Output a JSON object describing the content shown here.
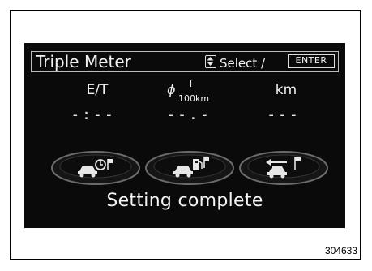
{
  "screen": {
    "title": "Triple Meter",
    "select_label": "Select /",
    "enter_key": "ENTER",
    "columns": [
      {
        "label": "E/T",
        "value": "-:--",
        "icon": "car-clock-icon"
      },
      {
        "label_prefix": "ϕ",
        "fraction_num": "l",
        "fraction_den": "100km",
        "value": "--.-",
        "icon": "car-fuel-pump-icon"
      },
      {
        "label": "km",
        "value": "---",
        "icon": "car-flag-icon"
      }
    ],
    "status": "Setting complete"
  },
  "figure_code": "304633",
  "colors": {
    "screen_bg": "#0a0a0a",
    "text": "#f0f0f0",
    "dial": "#5f5f5f"
  }
}
